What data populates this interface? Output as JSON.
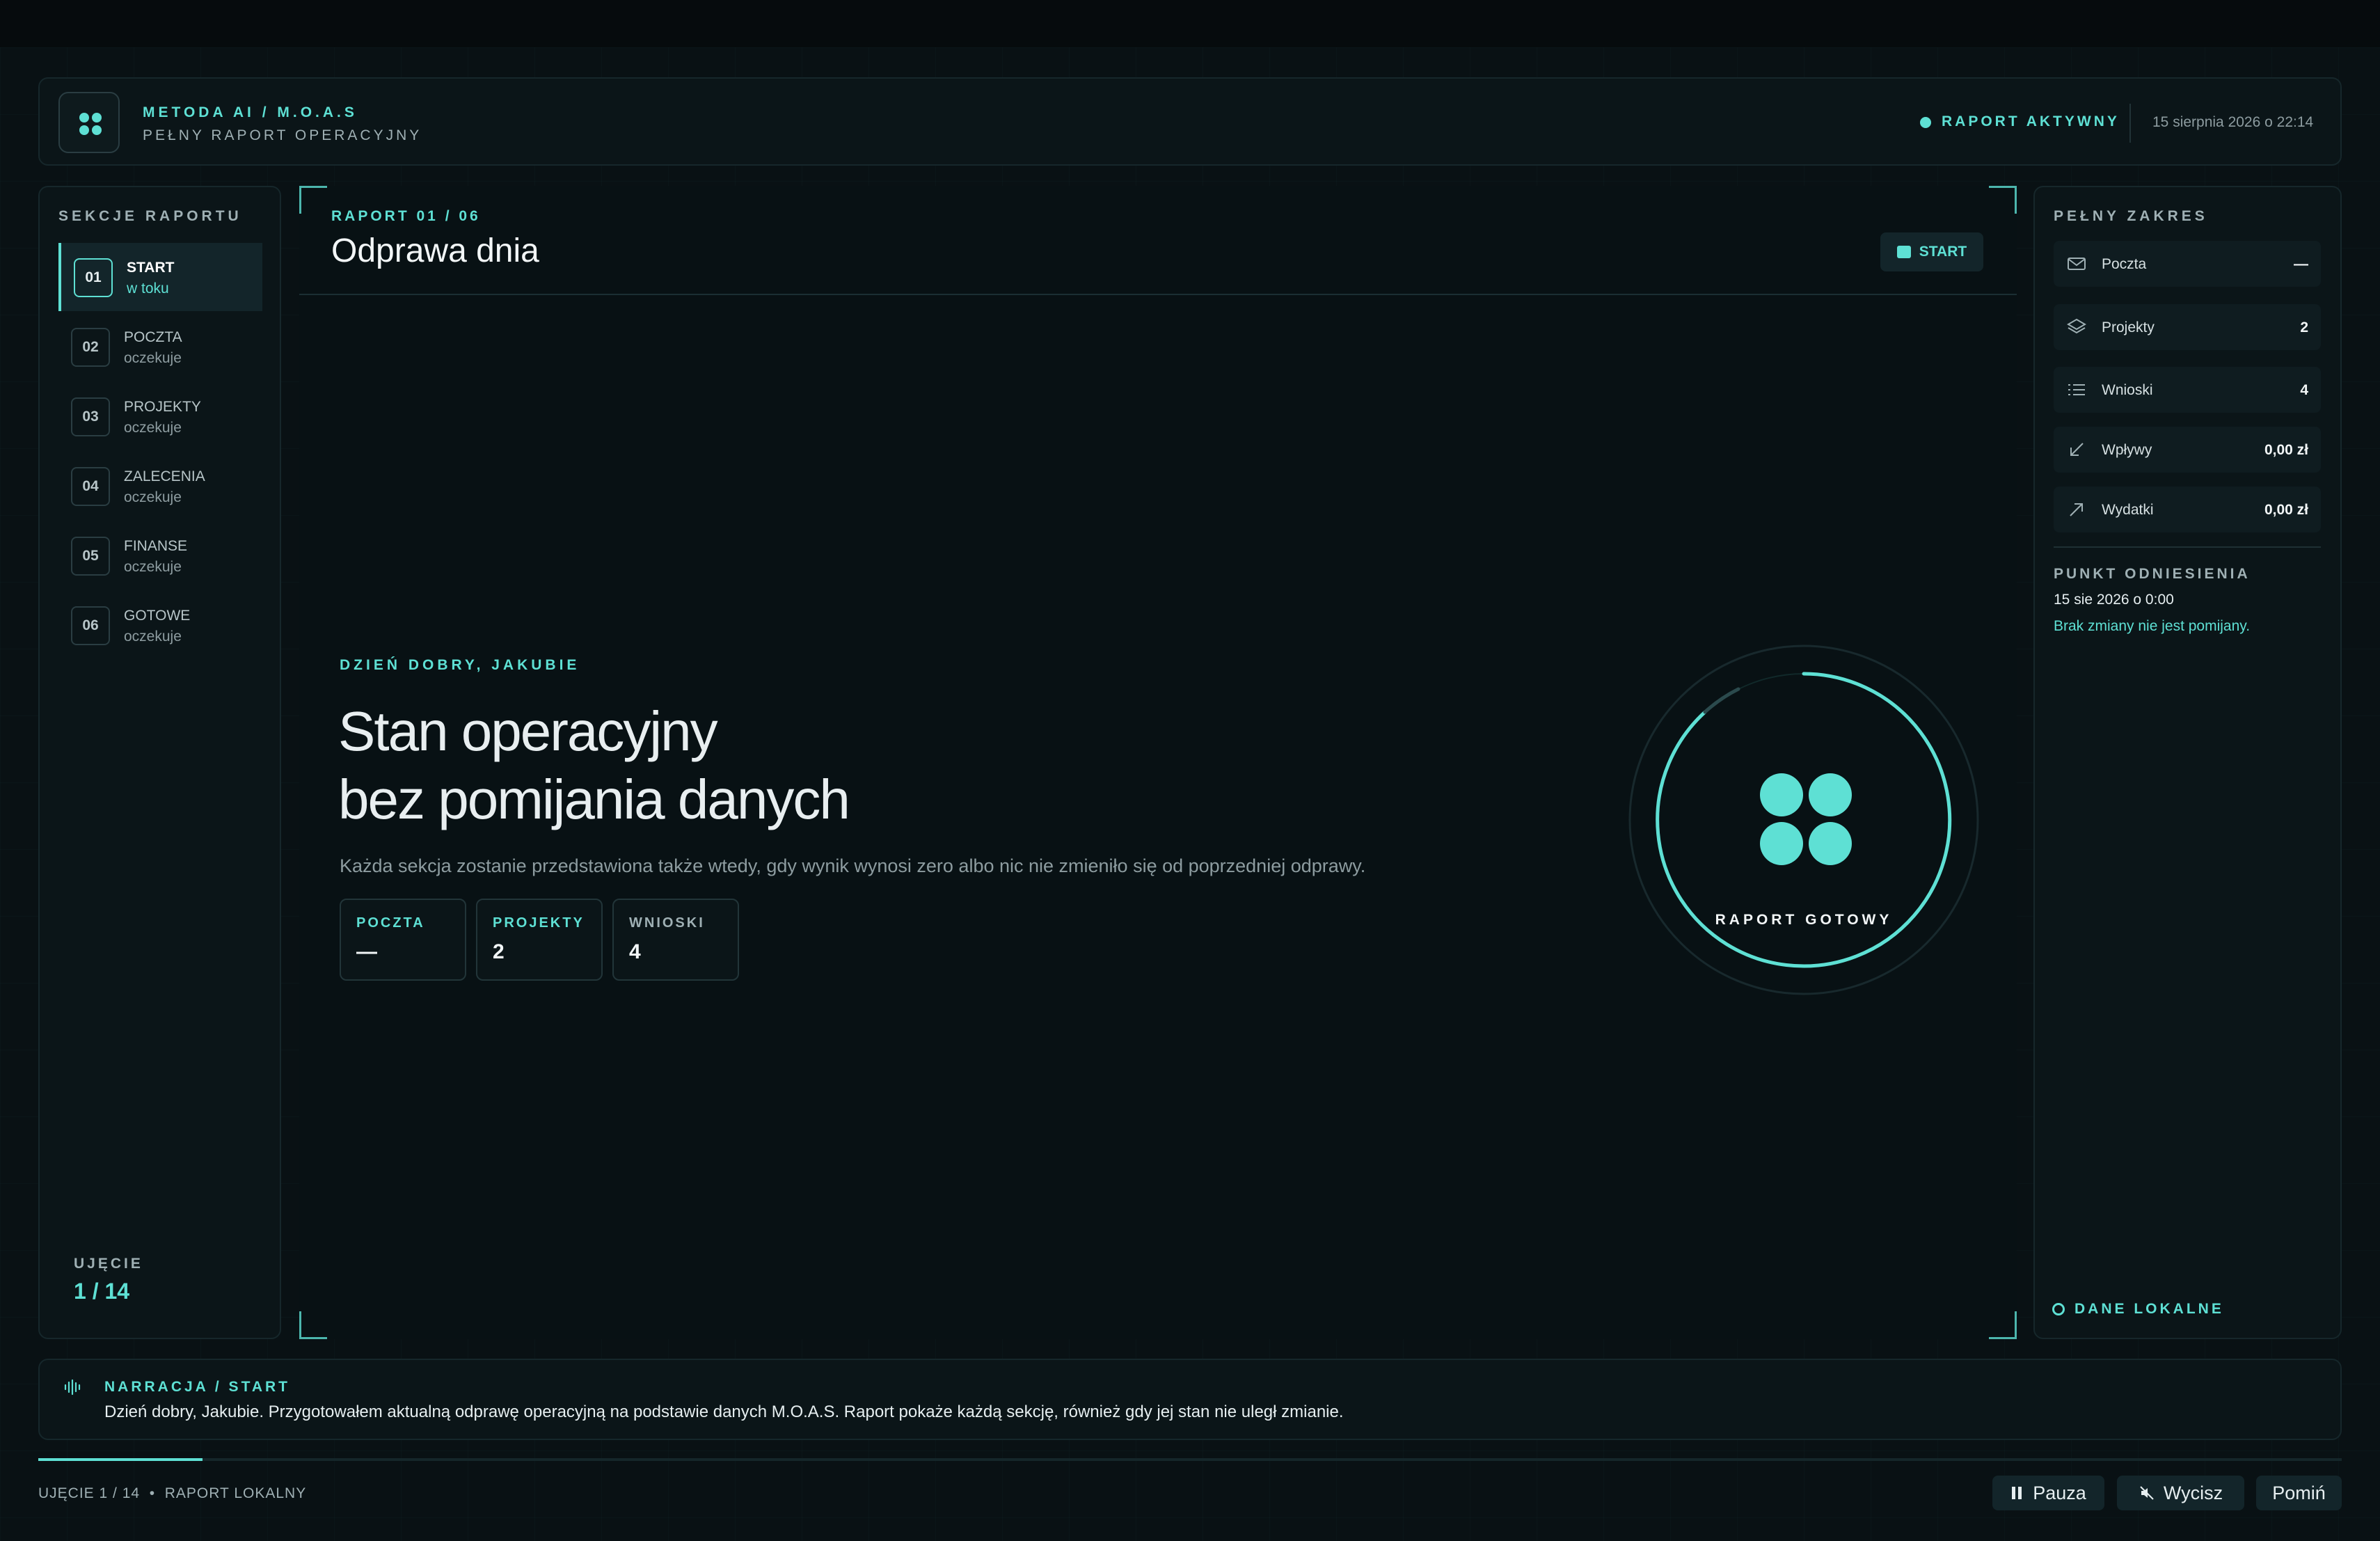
{
  "header": {
    "brand_title": "METODA AI / M.O.A.S",
    "brand_subtitle": "PEŁNY RAPORT OPERACYJNY",
    "status": "RAPORT AKTYWNY",
    "datetime": "15 sierpnia 2026 o 22:14",
    "accent_color": "#5ee0d4"
  },
  "sidebar": {
    "title": "SEKCJE RAPORTU",
    "steps": [
      {
        "num": "01",
        "name": "START",
        "state": "w toku",
        "active": true
      },
      {
        "num": "02",
        "name": "POCZTA",
        "state": "oczekuje",
        "active": false
      },
      {
        "num": "03",
        "name": "PROJEKTY",
        "state": "oczekuje",
        "active": false
      },
      {
        "num": "04",
        "name": "ZALECENIA",
        "state": "oczekuje",
        "active": false
      },
      {
        "num": "05",
        "name": "FINANSE",
        "state": "oczekuje",
        "active": false
      },
      {
        "num": "06",
        "name": "GOTOWE",
        "state": "oczekuje",
        "active": false
      }
    ],
    "shot_label": "UJĘCIE",
    "shot_value": "1 / 14"
  },
  "main": {
    "kicker": "RAPORT 01 / 06",
    "title": "Odprawa dnia",
    "chip_label": "START",
    "greeting": "DZIEŃ DOBRY, JAKUBIE",
    "headline_line1": "Stan operacyjny",
    "headline_line2": "bez pomijania danych",
    "lead": "Każda sekcja zostanie przedstawiona także wtedy, gdy wynik wynosi zero albo nic nie zmieniło się od poprzedniej odprawy.",
    "cards": [
      {
        "key": "POCZTA",
        "value": "—"
      },
      {
        "key": "PROJEKTY",
        "value": "2"
      },
      {
        "key": "WNIOSKI",
        "value": "4"
      }
    ],
    "ring_label": "RAPORT GOTOWY"
  },
  "right": {
    "title": "PEŁNY ZAKRES",
    "rows": [
      {
        "name": "Poczta",
        "value": "—",
        "icon": "mail-icon"
      },
      {
        "name": "Projekty",
        "value": "2",
        "icon": "layers-icon"
      },
      {
        "name": "Wnioski",
        "value": "4",
        "icon": "list-icon"
      },
      {
        "name": "Wpływy",
        "value": "0,00 zł",
        "icon": "arrow-down-left-icon"
      },
      {
        "name": "Wydatki",
        "value": "0,00 zł",
        "icon": "arrow-up-right-icon"
      }
    ],
    "ref_title": "PUNKT ODNIESIENIA",
    "ref_date": "15 sie 2026 o 0:00",
    "ref_note": "Brak zmiany nie jest pomijany.",
    "local_data": "DANE LOKALNE"
  },
  "narration": {
    "title": "NARRACJA / START",
    "text": "Dzień dobry, Jakubie. Przygotowałem aktualną odprawę operacyjną na podstawie danych M.O.A.S. Raport pokaże każdą sekcję, również gdy jej stan nie uległ zmianie."
  },
  "footer": {
    "info": "UJĘCIE 1 / 14  •  RAPORT LOKALNY",
    "progress_fraction": 0.0714,
    "pause_label": "Pauza",
    "mute_label": "Wycisz",
    "skip_label": "Pomiń"
  }
}
